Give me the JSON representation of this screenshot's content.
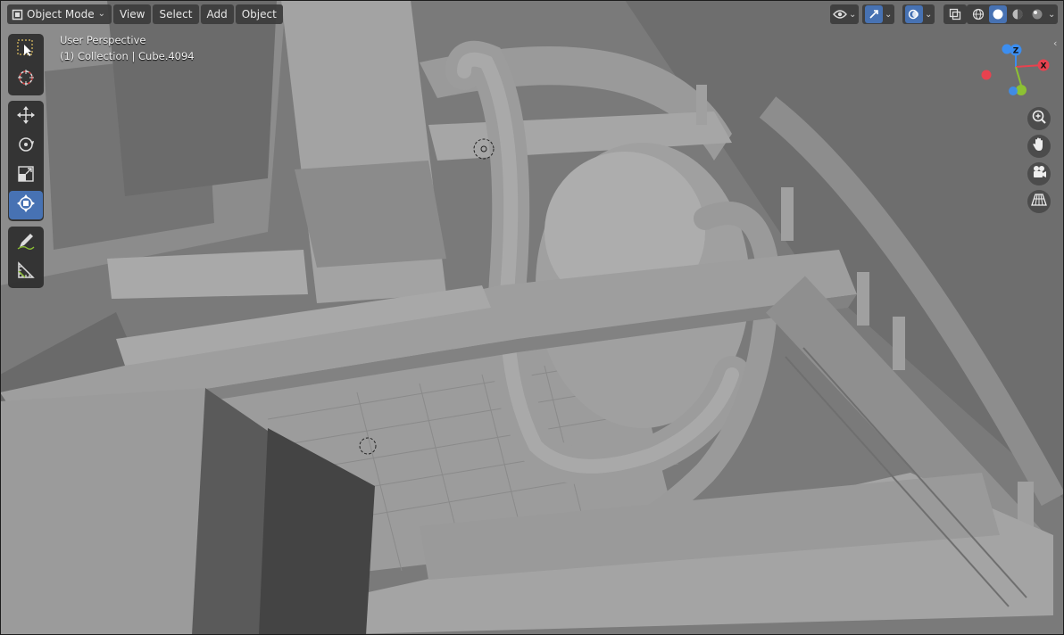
{
  "header": {
    "mode_label": "Object Mode",
    "menus": [
      "View",
      "Select",
      "Add",
      "Object"
    ]
  },
  "overlay": {
    "perspective": "User Perspective",
    "object_info": "(1) Collection | Cube.4094"
  },
  "gizmo": {
    "z_label": "Z",
    "x_label": "X"
  },
  "toolbar": {
    "tools": [
      "select-box",
      "cursor",
      "move",
      "rotate",
      "scale",
      "transform",
      "annotate",
      "measure"
    ],
    "active_tool": "transform"
  },
  "navigation": [
    "zoom-icon",
    "hand-pan-icon",
    "camera-icon",
    "grid-perspective-icon"
  ],
  "shading": {
    "active_mode": "solid"
  },
  "colors": {
    "accent": "#4772b3",
    "x_axis": "#e8424f",
    "y_axis": "#8dc133",
    "z_axis": "#3c8ef0"
  }
}
